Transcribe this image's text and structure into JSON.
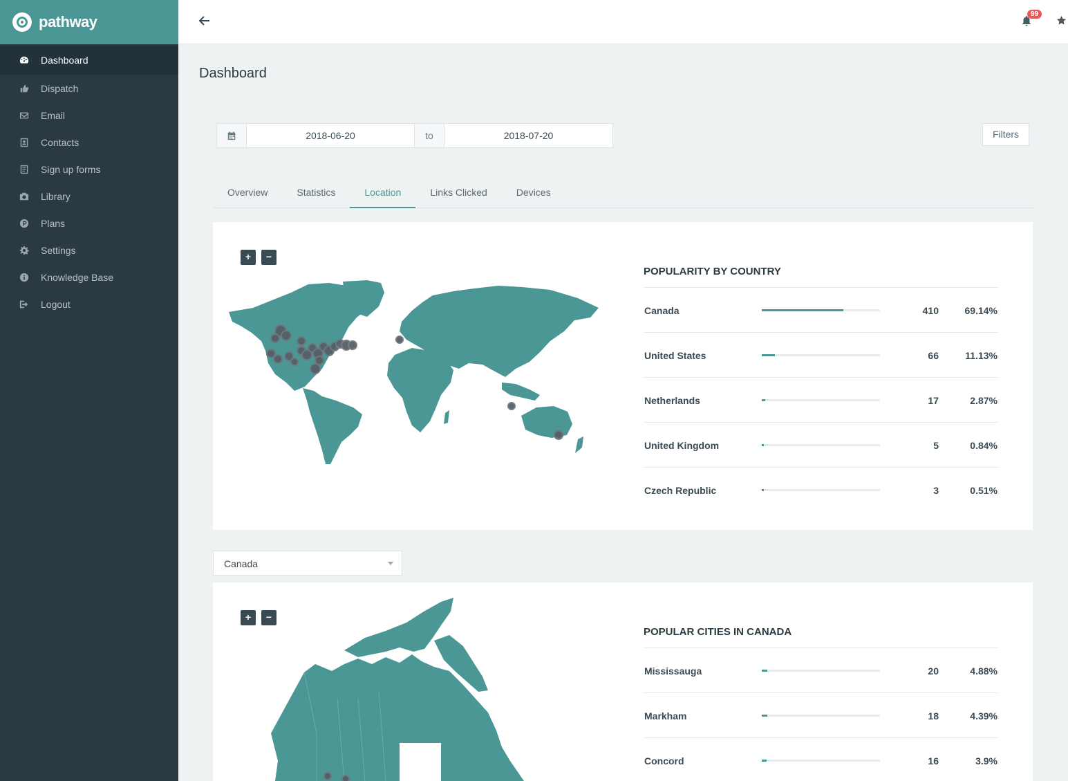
{
  "brand": {
    "name": "pathway"
  },
  "sidebar": {
    "items": [
      {
        "label": "Dashboard",
        "icon": "dashboard-icon",
        "active": true
      },
      {
        "label": "Dispatch",
        "icon": "thumbs-up-icon"
      },
      {
        "label": "Email",
        "icon": "envelope-icon"
      },
      {
        "label": "Contacts",
        "icon": "contact-card-icon"
      },
      {
        "label": "Sign up forms",
        "icon": "form-icon"
      },
      {
        "label": "Library",
        "icon": "camera-icon"
      },
      {
        "label": "Plans",
        "icon": "plans-p-icon"
      },
      {
        "label": "Settings",
        "icon": "gear-icon"
      },
      {
        "label": "Knowledge Base",
        "icon": "info-icon"
      },
      {
        "label": "Logout",
        "icon": "logout-icon"
      }
    ]
  },
  "header": {
    "notifications": "99"
  },
  "page": {
    "title": "Dashboard",
    "date_from": "2018-06-20",
    "date_to": "2018-07-20",
    "to_label": "to",
    "filters_label": "Filters"
  },
  "tabs": [
    {
      "label": "Overview"
    },
    {
      "label": "Statistics"
    },
    {
      "label": "Location",
      "active": true
    },
    {
      "label": "Links Clicked"
    },
    {
      "label": "Devices"
    }
  ],
  "zoom": {
    "in": "+",
    "out": "−"
  },
  "country_stats": {
    "title": "POPULARITY BY COUNTRY",
    "rows": [
      {
        "name": "Canada",
        "count": "410",
        "pct": "69.14%",
        "fraction": 0.6914
      },
      {
        "name": "United States",
        "count": "66",
        "pct": "11.13%",
        "fraction": 0.1113
      },
      {
        "name": "Netherlands",
        "count": "17",
        "pct": "2.87%",
        "fraction": 0.0287
      },
      {
        "name": "United Kingdom",
        "count": "5",
        "pct": "0.84%",
        "fraction": 0.0084
      },
      {
        "name": "Czech Republic",
        "count": "3",
        "pct": "0.51%",
        "fraction": 0.0051
      }
    ]
  },
  "country_select": {
    "value": "Canada"
  },
  "city_stats": {
    "title": "POPULAR CITIES IN CANADA",
    "rows": [
      {
        "name": "Mississauga",
        "count": "20",
        "pct": "4.88%",
        "fraction": 0.0488
      },
      {
        "name": "Markham",
        "count": "18",
        "pct": "4.39%",
        "fraction": 0.0439
      },
      {
        "name": "Concord",
        "count": "16",
        "pct": "3.9%",
        "fraction": 0.039
      }
    ]
  },
  "colors": {
    "accent": "#4a9796",
    "sidebar": "#2b3a42",
    "badge": "#e45a5a",
    "marker": "#555f66"
  }
}
